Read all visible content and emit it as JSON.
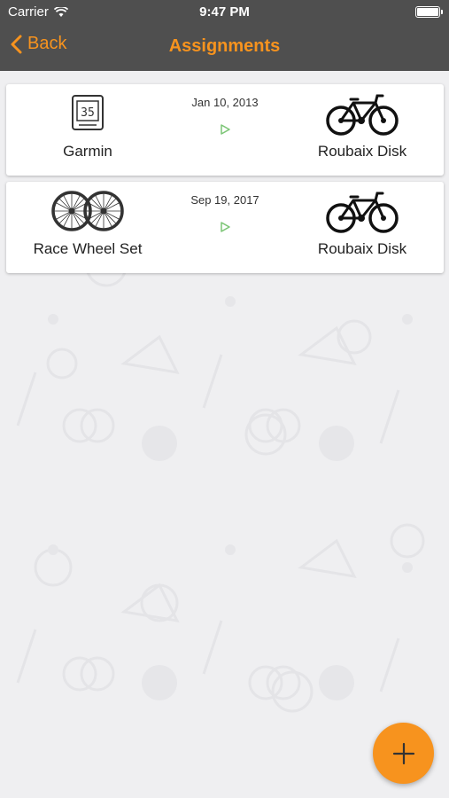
{
  "status_bar": {
    "carrier": "Carrier",
    "time": "9:47 PM"
  },
  "nav": {
    "back_label": "Back",
    "title": "Assignments"
  },
  "colors": {
    "accent": "#f7931e",
    "header_bg": "#4f4f4f",
    "arrow": "#7cc576"
  },
  "assignments": [
    {
      "from": {
        "label": "Garmin",
        "icon": "garmin-device-icon",
        "device_reading": "35"
      },
      "date": "Jan 10, 2013",
      "to": {
        "label": "Roubaix Disk",
        "icon": "road-bike-icon"
      }
    },
    {
      "from": {
        "label": "Race Wheel Set",
        "icon": "wheel-set-icon"
      },
      "date": "Sep 19, 2017",
      "to": {
        "label": "Roubaix Disk",
        "icon": "road-bike-icon"
      }
    }
  ],
  "fab": {
    "icon": "plus-icon"
  }
}
